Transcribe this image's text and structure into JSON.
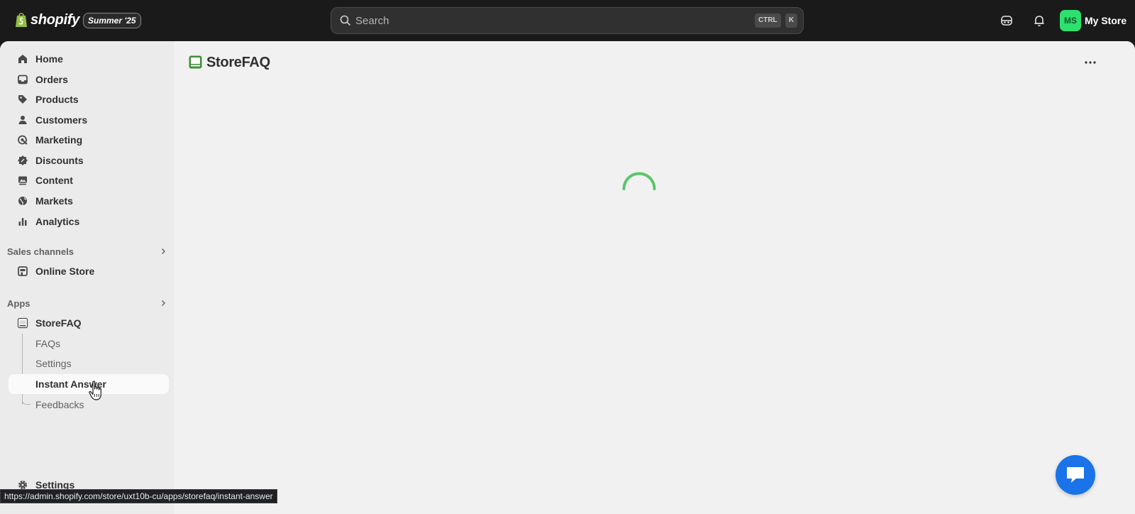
{
  "topbar": {
    "brand": "shopify",
    "edition_badge": "Summer '25",
    "search": {
      "placeholder": "Search",
      "shortcut_1": "CTRL",
      "shortcut_2": "K"
    },
    "store": {
      "avatar_initials": "MS",
      "name": "My Store",
      "avatar_color": "#2ee06e"
    },
    "icons": [
      "sidekick-icon",
      "bell-icon"
    ]
  },
  "sidebar": {
    "items": [
      {
        "label": "Home",
        "icon": "home-icon"
      },
      {
        "label": "Orders",
        "icon": "inbox-icon"
      },
      {
        "label": "Products",
        "icon": "tag-icon"
      },
      {
        "label": "Customers",
        "icon": "person-icon"
      },
      {
        "label": "Marketing",
        "icon": "target-icon"
      },
      {
        "label": "Discounts",
        "icon": "discount-icon"
      },
      {
        "label": "Content",
        "icon": "image-icon"
      },
      {
        "label": "Markets",
        "icon": "globe-icon"
      },
      {
        "label": "Analytics",
        "icon": "bar-chart-icon"
      }
    ],
    "sales_channels": {
      "heading": "Sales channels",
      "items": [
        {
          "label": "Online Store",
          "icon": "store-icon"
        }
      ]
    },
    "apps": {
      "heading": "Apps",
      "app": {
        "label": "StoreFAQ",
        "icon": "faq-icon"
      },
      "subitems": [
        "FAQs",
        "Settings",
        "Instant Answer",
        "Feedbacks"
      ],
      "active_subitem": "Instant Answer"
    },
    "footer": {
      "label": "Settings",
      "icon": "gear-icon"
    }
  },
  "main": {
    "app_title": "StoreFAQ",
    "loading": true,
    "spinner_color": "#5cc46a"
  },
  "status_bar": {
    "url": "https://admin.shopify.com/store/uxt10b-cu/apps/storefaq/instant-answer"
  },
  "colors": {
    "topbar": "#1a1a1a",
    "sidebar": "#ebebeb",
    "main": "#f1f1f1",
    "chat": "#1a73e8"
  }
}
